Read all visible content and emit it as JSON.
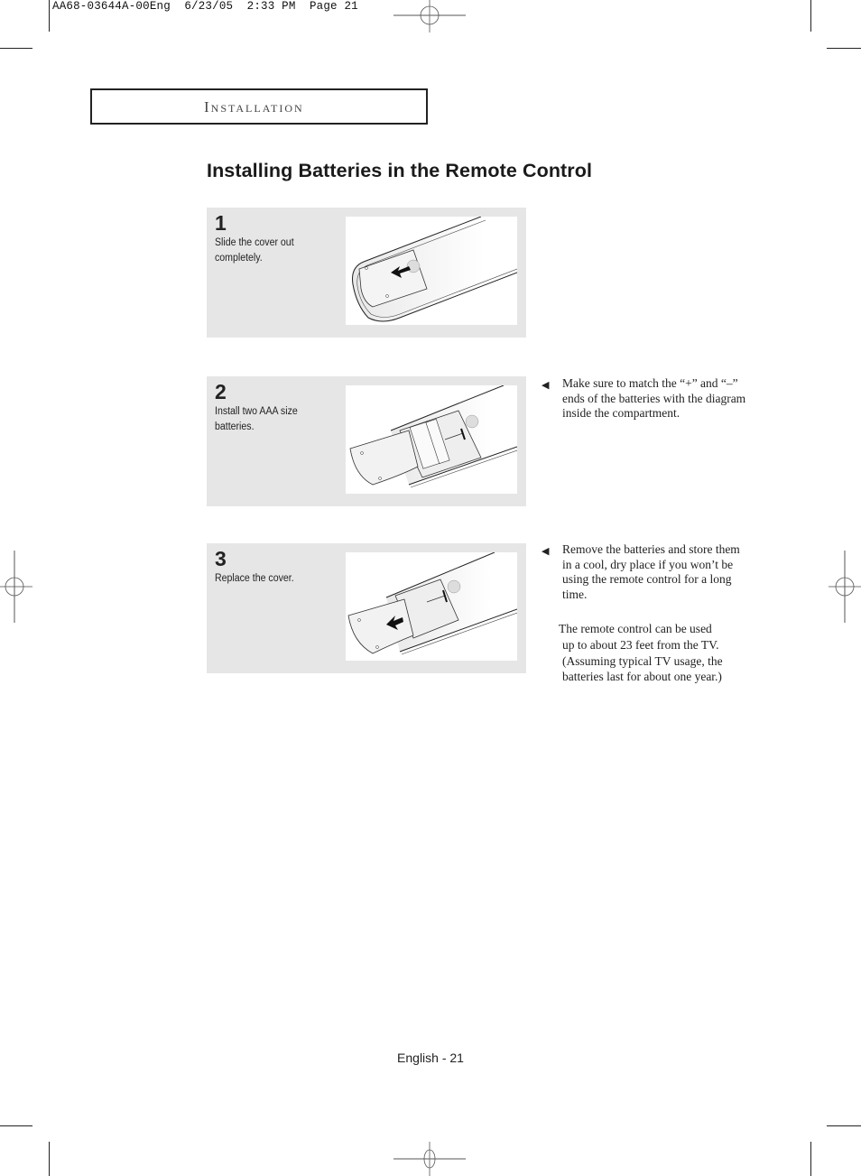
{
  "print_slug": "AA68-03644A-00Eng  6/23/05  2:33 PM  Page 21",
  "section": {
    "first_letter": "I",
    "rest": "NSTALLATION"
  },
  "page_title": "Installing Batteries in the Remote Control",
  "steps": [
    {
      "number": "1",
      "text": "Slide the cover out completely.",
      "illustration": "remote-cover-slide-out-illustration"
    },
    {
      "number": "2",
      "text": "Install two AAA size batteries.",
      "illustration": "remote-battery-install-illustration"
    },
    {
      "number": "3",
      "text": "Replace the cover.",
      "illustration": "remote-cover-replace-illustration"
    }
  ],
  "notes": [
    {
      "icon": "triangle-bullet-icon",
      "text": "Make sure to match the “+” and “–” ends of the batteries with the diagram inside the compartment."
    },
    {
      "icon": "triangle-bullet-icon",
      "text": "Remove the batteries and store them in a cool, dry place if you won’t be using the remote control for a long time."
    }
  ],
  "range_note": {
    "lines": [
      "The remote control can be used",
      "up to about 23 feet from the TV.",
      "(Assuming typical TV usage, the",
      "batteries last for about one year.)"
    ]
  },
  "bullet_glyph": "◀",
  "footer": "English - 21"
}
